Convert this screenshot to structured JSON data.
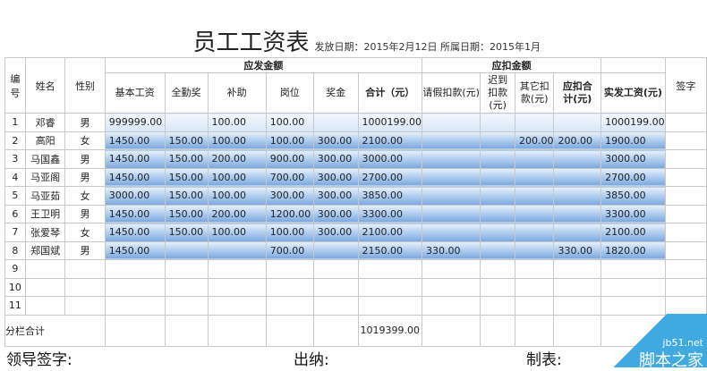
{
  "title": "员工工资表",
  "subtitle": "发放日期：2015年2月12日 所属日期：2015年1月",
  "headers": {
    "no": "编号",
    "name": "姓名",
    "gender": "性别",
    "group_pay": "应发金额",
    "group_deduct": "应扣金额",
    "sign": "签字",
    "cols": [
      "基本工资",
      "全勤奖",
      "补助",
      "岗位",
      "奖金",
      "合计（元）",
      "请假扣款(元)",
      "迟到扣款(元)",
      "其它扣款(元)",
      "应扣合计(元)",
      "实发工资(元)"
    ]
  },
  "rows": [
    {
      "no": "1",
      "name": "邓睿",
      "gender": "男",
      "v": [
        "999999.00",
        "",
        "100.00",
        "100.00",
        "",
        "1000199.00",
        "",
        "",
        "",
        "",
        "1000199.00"
      ]
    },
    {
      "no": "2",
      "name": "高阳",
      "gender": "女",
      "v": [
        "1450.00",
        "150.00",
        "100.00",
        "100.00",
        "300.00",
        "2100.00",
        "",
        "",
        "200.00",
        "200.00",
        "1900.00"
      ]
    },
    {
      "no": "3",
      "name": "马国鑫",
      "gender": "男",
      "v": [
        "1450.00",
        "150.00",
        "200.00",
        "900.00",
        "300.00",
        "3000.00",
        "",
        "",
        "",
        "",
        "3000.00"
      ]
    },
    {
      "no": "4",
      "name": "马亚阁",
      "gender": "男",
      "v": [
        "1450.00",
        "150.00",
        "100.00",
        "700.00",
        "300.00",
        "2700.00",
        "",
        "",
        "",
        "",
        "2700.00"
      ]
    },
    {
      "no": "5",
      "name": "马亚茹",
      "gender": "女",
      "v": [
        "3000.00",
        "150.00",
        "100.00",
        "300.00",
        "300.00",
        "3850.00",
        "",
        "",
        "",
        "",
        "3850.00"
      ]
    },
    {
      "no": "6",
      "name": "王卫明",
      "gender": "男",
      "v": [
        "1450.00",
        "150.00",
        "200.00",
        "1200.00",
        "300.00",
        "3300.00",
        "",
        "",
        "",
        "",
        "3300.00"
      ]
    },
    {
      "no": "7",
      "name": "张爱琴",
      "gender": "女",
      "v": [
        "1450.00",
        "150.00",
        "100.00",
        "100.00",
        "300.00",
        "2100.00",
        "",
        "",
        "",
        "",
        "2100.00"
      ]
    },
    {
      "no": "8",
      "name": "郑国斌",
      "gender": "男",
      "v": [
        "1450.00",
        "",
        "",
        "700.00",
        "",
        "2150.00",
        "330.00",
        "",
        "",
        "330.00",
        "1820.00"
      ]
    },
    {
      "no": "9"
    },
    {
      "no": "10"
    },
    {
      "no": "11"
    }
  ],
  "subtotal_label": "分栏合计",
  "subtotal_value": "1019399.00",
  "footer": {
    "leader": "领导签字:",
    "cashier": "出纳:",
    "maker": "制表:"
  },
  "watermark": {
    "url": "jb51.net",
    "name": "脚本之家"
  }
}
